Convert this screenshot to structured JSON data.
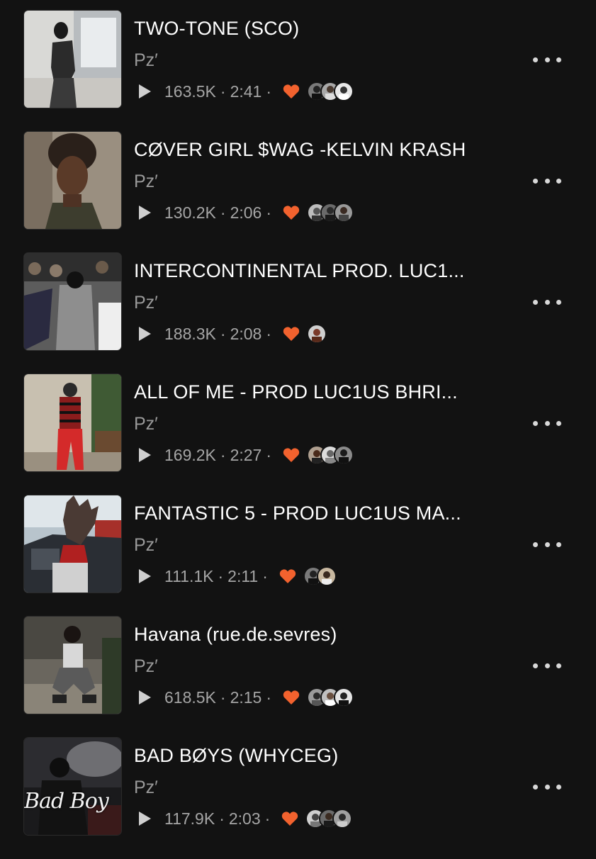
{
  "colors": {
    "background": "#121212",
    "title": "#ffffff",
    "secondary": "#9a9a9a",
    "heart": "#f2622e"
  },
  "tracks": [
    {
      "title": "TWO-TONE (SCO)",
      "artist": "Pz′",
      "plays": "163.5K",
      "duration": "2:41",
      "liked": true,
      "artwork_icon": "artwork-photo",
      "artwork_text": "",
      "likers": [
        "avatar-dark",
        "avatar-grey",
        "avatar-light"
      ]
    },
    {
      "title": "CØVER GIRL $WAG -KELVIN KRASH",
      "artist": "Pz′",
      "plays": "130.2K",
      "duration": "2:06",
      "liked": true,
      "artwork_icon": "artwork-photo",
      "artwork_text": "",
      "likers": [
        "avatar-grey",
        "avatar-dark",
        "avatar-grey"
      ]
    },
    {
      "title": "INTERCONTINENTAL PROD. LUC1...",
      "artist": "Pz′",
      "plays": "188.3K",
      "duration": "2:08",
      "liked": true,
      "artwork_icon": "artwork-photo",
      "artwork_text": "",
      "likers": [
        "avatar-grey"
      ]
    },
    {
      "title": "ALL OF ME - PROD LUC1US BHRI...",
      "artist": "Pz′",
      "plays": "169.2K",
      "duration": "2:27",
      "liked": true,
      "artwork_icon": "artwork-photo",
      "artwork_text": "",
      "likers": [
        "avatar-grey",
        "avatar-light",
        "avatar-dark"
      ]
    },
    {
      "title": "FANTASTIC 5 - PROD LUC1US MA...",
      "artist": "Pz′",
      "plays": "111.1K",
      "duration": "2:11",
      "liked": true,
      "artwork_icon": "artwork-photo",
      "artwork_text": "",
      "likers": [
        "avatar-dark",
        "avatar-light"
      ]
    },
    {
      "title": "Havana (rue.de.sevres)",
      "artist": "Pz′",
      "plays": "618.5K",
      "duration": "2:15",
      "liked": true,
      "artwork_icon": "artwork-photo",
      "artwork_text": "",
      "likers": [
        "avatar-grey",
        "avatar-light",
        "avatar-dark"
      ]
    },
    {
      "title": "BAD BØYS (WHYCEG)",
      "artist": "Pz′",
      "plays": "117.9K",
      "duration": "2:03",
      "liked": true,
      "artwork_icon": "artwork-photo",
      "artwork_text": "Bad Boy",
      "likers": [
        "avatar-light",
        "avatar-dark",
        "avatar-grey"
      ]
    }
  ]
}
